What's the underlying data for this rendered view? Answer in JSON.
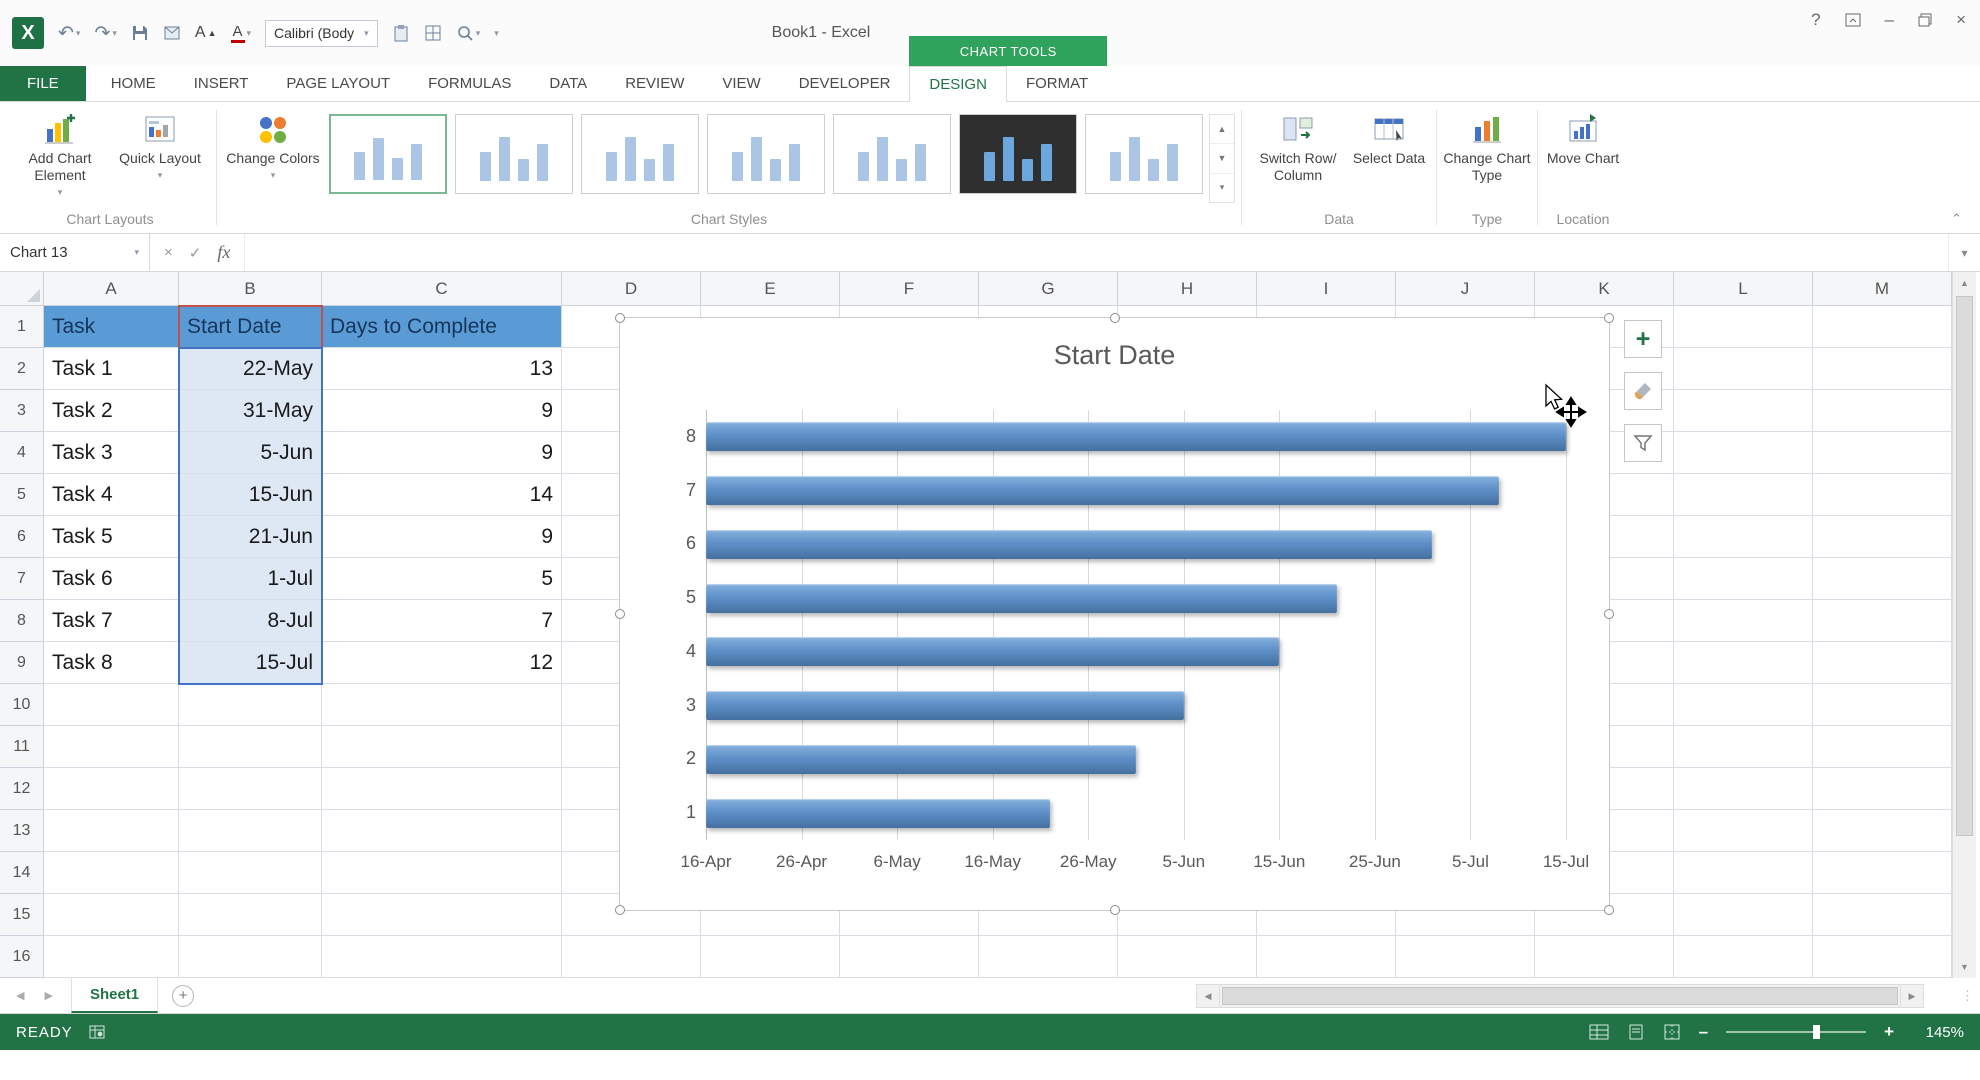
{
  "titlebar": {
    "document_title": "Book1 - Excel",
    "help_label": "?",
    "font_name_box": "Calibri (Body"
  },
  "colors": {
    "excel_green": "#217346",
    "contextual_tab_green": "#2fa25b",
    "table_header_fill": "#5b9bd5",
    "selected_value_range_fill": "#dde8f4",
    "value_range_border": "#4472c4",
    "header_range_border": "#c0504d",
    "chart_bar_blue": "#5b8ec9"
  },
  "ribbon": {
    "tabs": [
      {
        "label": "FILE",
        "file": true
      },
      {
        "label": "HOME"
      },
      {
        "label": "INSERT"
      },
      {
        "label": "PAGE LAYOUT"
      },
      {
        "label": "FORMULAS"
      },
      {
        "label": "DATA"
      },
      {
        "label": "REVIEW"
      },
      {
        "label": "VIEW"
      },
      {
        "label": "DEVELOPER"
      }
    ],
    "contextual": {
      "label": "CHART TOOLS",
      "tabs": [
        {
          "label": "DESIGN",
          "active": true
        },
        {
          "label": "FORMAT"
        }
      ]
    },
    "groups": {
      "chart_layouts": {
        "label": "Chart Layouts",
        "buttons": [
          {
            "label": "Add Chart Element"
          },
          {
            "label": "Quick Layout"
          }
        ]
      },
      "chart_styles": {
        "label": "Chart Styles",
        "change_colors_label": "Change Colors",
        "variants": [
          {
            "name": "Style 1",
            "selected": true
          },
          {
            "name": "Style 2"
          },
          {
            "name": "Style 3"
          },
          {
            "name": "Style 4"
          },
          {
            "name": "Style 5"
          },
          {
            "name": "Style 6",
            "dark": true
          },
          {
            "name": "Style 7"
          }
        ]
      },
      "data": {
        "label": "Data",
        "buttons": [
          {
            "label": "Switch Row/ Column"
          },
          {
            "label": "Select Data"
          }
        ]
      },
      "type": {
        "label": "Type",
        "buttons": [
          {
            "label": "Change Chart Type"
          }
        ]
      },
      "location": {
        "label": "Location",
        "buttons": [
          {
            "label": "Move Chart"
          }
        ]
      }
    }
  },
  "formula_bar": {
    "name_box": "Chart 13",
    "fx_label": "fx",
    "formula_value": ""
  },
  "sheet": {
    "columns": [
      "A",
      "B",
      "C",
      "D",
      "E",
      "F",
      "G",
      "H",
      "I",
      "J",
      "K",
      "L",
      "M"
    ],
    "row_count": 16,
    "table": {
      "headers": [
        "Task",
        "Start Date",
        "Days to Complete"
      ],
      "rows": [
        [
          "Task 1",
          "22-May",
          13
        ],
        [
          "Task 2",
          "31-May",
          9
        ],
        [
          "Task 3",
          "5-Jun",
          9
        ],
        [
          "Task 4",
          "15-Jun",
          14
        ],
        [
          "Task 5",
          "21-Jun",
          9
        ],
        [
          "Task 6",
          "1-Jul",
          5
        ],
        [
          "Task 7",
          "8-Jul",
          7
        ],
        [
          "Task 8",
          "15-Jul",
          12
        ]
      ]
    }
  },
  "chart_data": {
    "type": "bar",
    "orientation": "horizontal",
    "title": "Start Date",
    "categories": [
      "1",
      "2",
      "3",
      "4",
      "5",
      "6",
      "7",
      "8"
    ],
    "series": [
      {
        "name": "Start Date",
        "values_days_after_axis_start": [
          36,
          45,
          50,
          60,
          66,
          76,
          83,
          90
        ],
        "value_labels": [
          "22-May",
          "31-May",
          "5-Jun",
          "15-Jun",
          "21-Jun",
          "1-Jul",
          "8-Jul",
          "15-Jul"
        ]
      }
    ],
    "x_axis": {
      "tick_labels": [
        "16-Apr",
        "26-Apr",
        "6-May",
        "16-May",
        "26-May",
        "5-Jun",
        "15-Jun",
        "25-Jun",
        "5-Jul",
        "15-Jul"
      ],
      "tick_interval_days": 10,
      "range_days": [
        0,
        90
      ]
    },
    "y_axis": {
      "order_top_to_bottom": [
        "8",
        "7",
        "6",
        "5",
        "4",
        "3",
        "2",
        "1"
      ]
    },
    "grid": true,
    "legend": false
  },
  "sheet_tabs": {
    "active": "Sheet1",
    "add_label": "+"
  },
  "status_bar": {
    "mode": "READY",
    "zoom": "145%"
  }
}
